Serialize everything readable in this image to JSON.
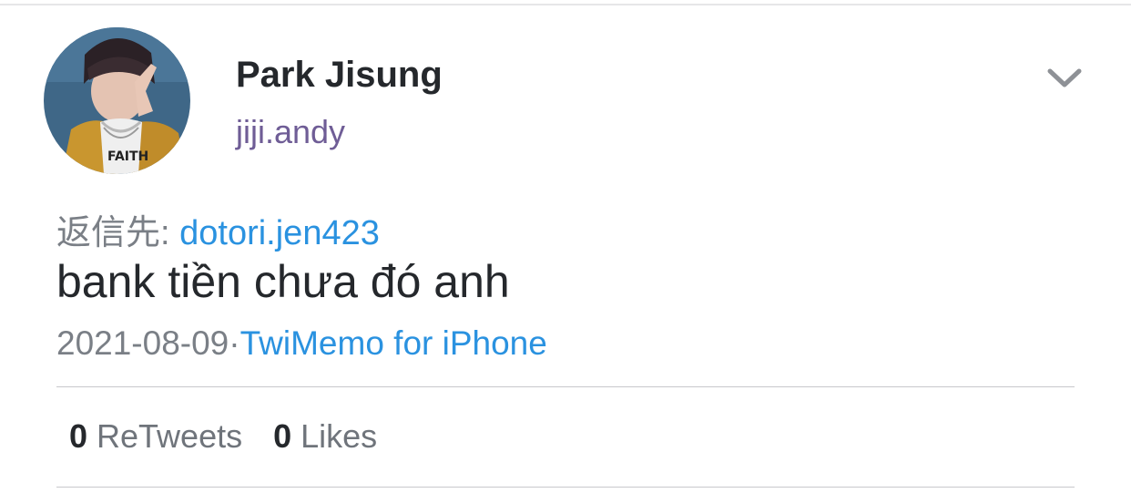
{
  "user": {
    "display_name": "Park Jisung",
    "handle": "jiji.andy",
    "avatar_label": "FAITH"
  },
  "reply": {
    "prefix": "返信先:",
    "target": "dotori.jen423"
  },
  "tweet": {
    "text": "bank tiền chưa đó anh",
    "date": "2021-08-09",
    "separator": "·",
    "source": "TwiMemo for iPhone"
  },
  "stats": {
    "retweets_count": "0",
    "retweets_label": "ReTweets",
    "likes_count": "0",
    "likes_label": "Likes"
  },
  "icons": {
    "menu": "chevron-down-icon"
  },
  "colors": {
    "name": "#25282c",
    "handle": "#6f5d96",
    "link": "#2a92e0",
    "muted": "#7a7f86",
    "divider": "#c8c8cc"
  }
}
